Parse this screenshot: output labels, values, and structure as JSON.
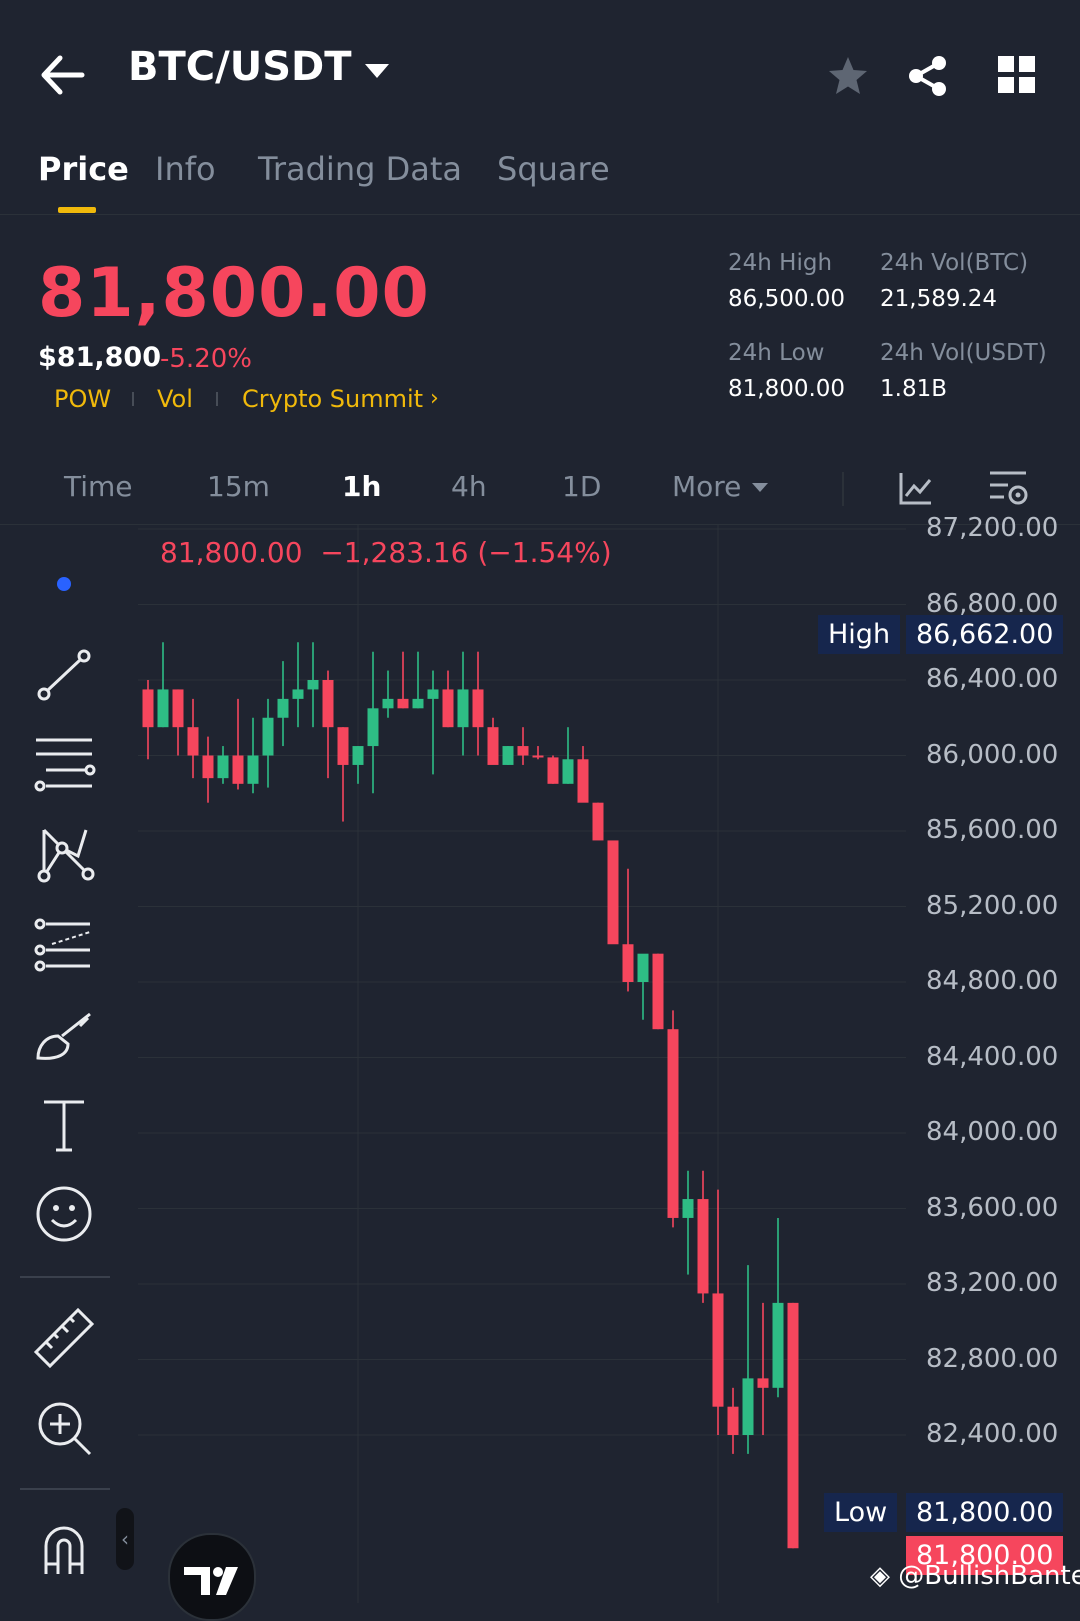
{
  "header": {
    "pair": "BTC/USDT",
    "back_icon": "arrow-left-icon",
    "favorite_icon": "star-icon",
    "share_icon": "share-icon",
    "layout_icon": "grid-icon"
  },
  "tabs": [
    {
      "label": "Price",
      "active": true
    },
    {
      "label": "Info",
      "active": false
    },
    {
      "label": "Trading Data",
      "active": false
    },
    {
      "label": "Square",
      "active": false
    }
  ],
  "price": {
    "last": "81,800.00",
    "usd": "$81,800",
    "change_pct": "-5.20%",
    "tags": [
      "POW",
      "Vol",
      "Crypto Summit"
    ],
    "stats": {
      "high_label": "24h High",
      "high_value": "86,500.00",
      "vol_btc_label": "24h Vol(BTC)",
      "vol_btc_value": "21,589.24",
      "low_label": "24h Low",
      "low_value": "81,800.00",
      "vol_usdt_label": "24h Vol(USDT)",
      "vol_usdt_value": "1.81B"
    }
  },
  "intervals": {
    "items": [
      "Time",
      "15m",
      "1h",
      "4h",
      "1D",
      "More"
    ],
    "active": "1h",
    "indicator_icon": "chart-indicator-icon",
    "settings_icon": "chart-settings-icon"
  },
  "tools": [
    "trend-line-icon",
    "horizontal-lines-icon",
    "pattern-icon",
    "fib-icon",
    "brush-icon",
    "text-icon",
    "emoji-icon",
    "ruler-icon",
    "zoom-in-icon",
    "magnet-icon"
  ],
  "chart_data": {
    "type": "candlestick",
    "header_price": "81,800.00",
    "header_change": "−1,283.16 (−1.54%)",
    "y_ticks": [
      "87,200.00",
      "86,800.00",
      "86,400.00",
      "86,000.00",
      "85,600.00",
      "85,200.00",
      "84,800.00",
      "84,400.00",
      "84,000.00",
      "83,600.00",
      "83,200.00",
      "82,800.00",
      "82,400.00"
    ],
    "ylim": [
      81500,
      87250
    ],
    "high_label": "High",
    "high_value": "86,662.00",
    "low_label": "Low",
    "low_value": "81,800.00",
    "current_value": "81,800.00",
    "up_color": "#2ebd85",
    "down_color": "#f6465d",
    "candles": [
      [
        86350,
        86400,
        85980,
        86150
      ],
      [
        86150,
        86600,
        86150,
        86350
      ],
      [
        86350,
        86350,
        86000,
        86150
      ],
      [
        86150,
        86300,
        85880,
        86000
      ],
      [
        86000,
        86100,
        85750,
        85880
      ],
      [
        85880,
        86050,
        85850,
        86000
      ],
      [
        86000,
        86300,
        85820,
        85850
      ],
      [
        85850,
        86200,
        85800,
        86000
      ],
      [
        86000,
        86300,
        85830,
        86200
      ],
      [
        86200,
        86500,
        86050,
        86300
      ],
      [
        86300,
        86600,
        86150,
        86350
      ],
      [
        86350,
        86600,
        86150,
        86400
      ],
      [
        86400,
        86450,
        85880,
        86150
      ],
      [
        86150,
        86150,
        85650,
        85950
      ],
      [
        85950,
        86050,
        85850,
        86050
      ],
      [
        86050,
        86550,
        85800,
        86250
      ],
      [
        86250,
        86450,
        86200,
        86300
      ],
      [
        86300,
        86550,
        86250,
        86250
      ],
      [
        86250,
        86550,
        86250,
        86300
      ],
      [
        86300,
        86450,
        85900,
        86350
      ],
      [
        86350,
        86450,
        86150,
        86150
      ],
      [
        86150,
        86550,
        86000,
        86350
      ],
      [
        86350,
        86550,
        86000,
        86150
      ],
      [
        86150,
        86200,
        85980,
        85950
      ],
      [
        85950,
        86050,
        85950,
        86050
      ],
      [
        86050,
        86150,
        85950,
        86000
      ],
      [
        86000,
        86050,
        85980,
        85990
      ],
      [
        85990,
        86000,
        85850,
        85850
      ],
      [
        85850,
        86150,
        85850,
        85980
      ],
      [
        85980,
        86050,
        85850,
        85750
      ],
      [
        85750,
        85750,
        85600,
        85550
      ],
      [
        85550,
        85500,
        85150,
        85000
      ],
      [
        85000,
        85400,
        84750,
        84800
      ],
      [
        84800,
        84900,
        84600,
        84950
      ],
      [
        84950,
        84950,
        84550,
        84550
      ],
      [
        84550,
        84650,
        83500,
        83550
      ],
      [
        83550,
        83800,
        83250,
        83650
      ],
      [
        83650,
        83800,
        83100,
        83150
      ],
      [
        83150,
        83700,
        82400,
        82550
      ],
      [
        82550,
        82650,
        82300,
        82400
      ],
      [
        82400,
        83300,
        82300,
        82700
      ],
      [
        82700,
        83100,
        82400,
        82650
      ],
      [
        82650,
        83550,
        82600,
        83100
      ],
      [
        83100,
        83100,
        81800,
        81800
      ]
    ]
  },
  "watermark": "@BullishBanter"
}
